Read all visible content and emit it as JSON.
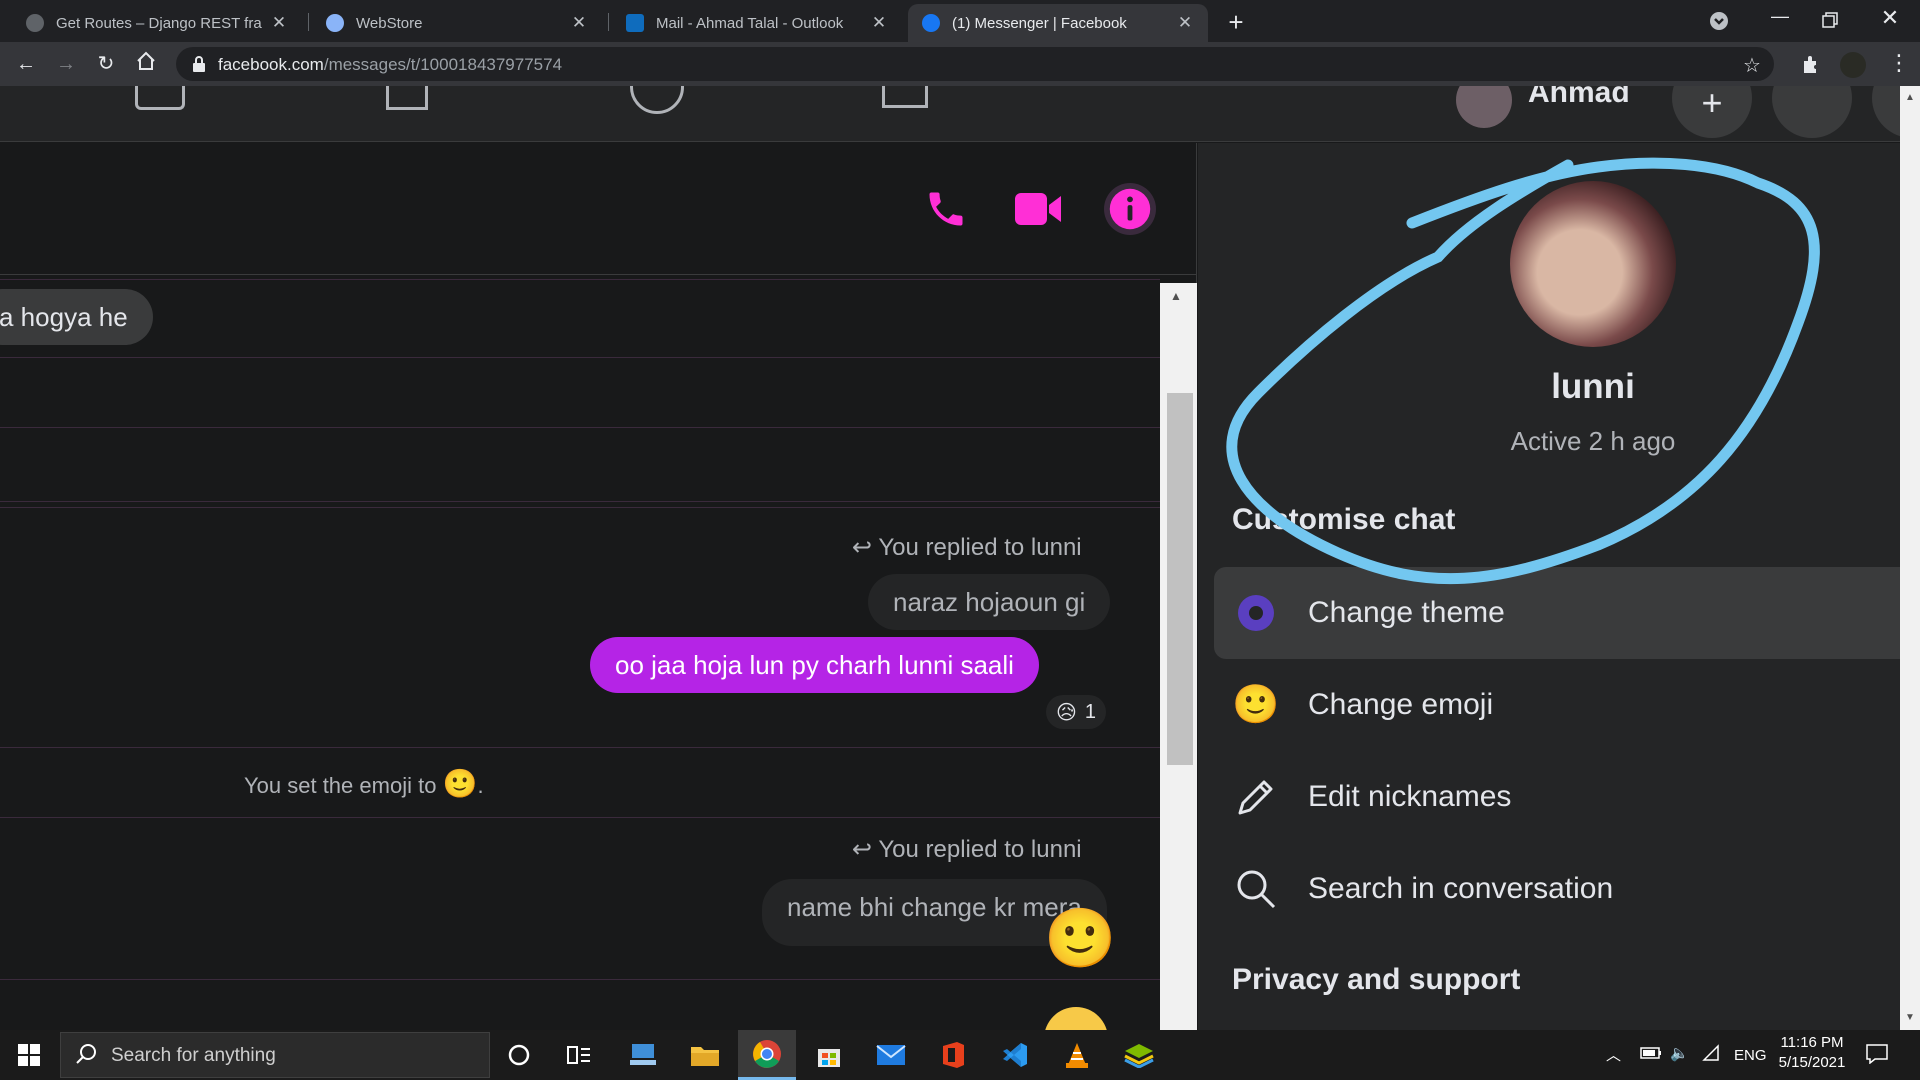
{
  "browser": {
    "tabs": [
      {
        "title": "Get Routes – Django REST framew",
        "favicon": "django-icon"
      },
      {
        "title": "WebStore",
        "favicon": "globe-icon"
      },
      {
        "title": "Mail - Ahmad Talal - Outlook",
        "favicon": "outlook-icon"
      },
      {
        "title": "(1) Messenger | Facebook",
        "favicon": "facebook-icon",
        "active": true
      }
    ],
    "new_tab": "+",
    "url_domain": "facebook.com",
    "url_path": "/messages/t/100018437977574"
  },
  "fb_nav": {
    "profile_name": "Ahmad"
  },
  "chat": {
    "messages": [
      {
        "type": "incoming",
        "text": "a hogya he"
      },
      {
        "type": "reply_meta",
        "text": "You replied to lunni"
      },
      {
        "type": "quoted",
        "text": "naraz hojaoun gi"
      },
      {
        "type": "outgoing",
        "text": "oo jaa hoja lun py charh lunni saali",
        "reaction": "😥",
        "reaction_count": "1"
      },
      {
        "type": "system",
        "text": "You set the emoji to",
        "emoji": "🙂",
        "suffix": "."
      },
      {
        "type": "reply_meta",
        "text": "You replied to lunni"
      },
      {
        "type": "quoted",
        "text": "name bhi change kr mera"
      },
      {
        "type": "emoji",
        "text": "🙂"
      }
    ]
  },
  "info": {
    "name": "lunni",
    "status": "Active 2 h ago",
    "section_customise": "Customise chat",
    "menu": [
      {
        "label": "Change theme",
        "icon": "theme-dot-icon"
      },
      {
        "label": "Change emoji",
        "icon": "emoji-icon"
      },
      {
        "label": "Edit nicknames",
        "icon": "pencil-icon"
      },
      {
        "label": "Search in conversation",
        "icon": "search-icon"
      }
    ],
    "section_privacy": "Privacy and support"
  },
  "taskbar": {
    "search_placeholder": "Search for anything",
    "lang": "ENG",
    "time": "11:16 PM",
    "date": "5/15/2021"
  },
  "colors": {
    "accent": "#ff2fd6",
    "outgoing_bubble": "#b524e6",
    "annotation": "#73c7f0"
  }
}
